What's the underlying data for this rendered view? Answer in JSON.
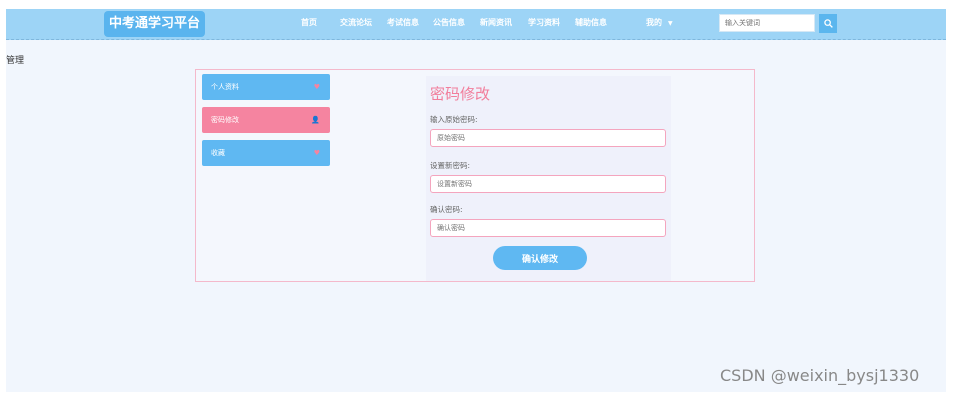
{
  "brand": {
    "logo": "中考通学习平台"
  },
  "nav": {
    "items": [
      "首页",
      "交流论坛",
      "考试信息",
      "公告信息",
      "新闻资讯",
      "学习资料",
      "辅助信息"
    ],
    "user_menu": "我的",
    "user_menu_caret": "▼"
  },
  "search": {
    "placeholder": "输入关键词"
  },
  "corner_label": "管理",
  "sidebar": {
    "items": [
      {
        "label": "个人资料",
        "icon": "♥"
      },
      {
        "label": "密码修改",
        "icon": "👤"
      },
      {
        "label": "收藏",
        "icon": "♥"
      }
    ],
    "active_index": 1
  },
  "form": {
    "title": "密码修改",
    "fields": [
      {
        "label": "输入原始密码:",
        "placeholder": "原始密码"
      },
      {
        "label": "设置新密码:",
        "placeholder": "设置新密码"
      },
      {
        "label": "确认密码:",
        "placeholder": "确认密码"
      }
    ],
    "submit_label": "确认修改"
  },
  "watermark": "CSDN @weixin_bysj1330",
  "colors": {
    "topbar": "#9dd4f6",
    "accent_blue": "#5fb8f2",
    "accent_pink": "#f584a0",
    "title_pink": "#f27d9b"
  }
}
